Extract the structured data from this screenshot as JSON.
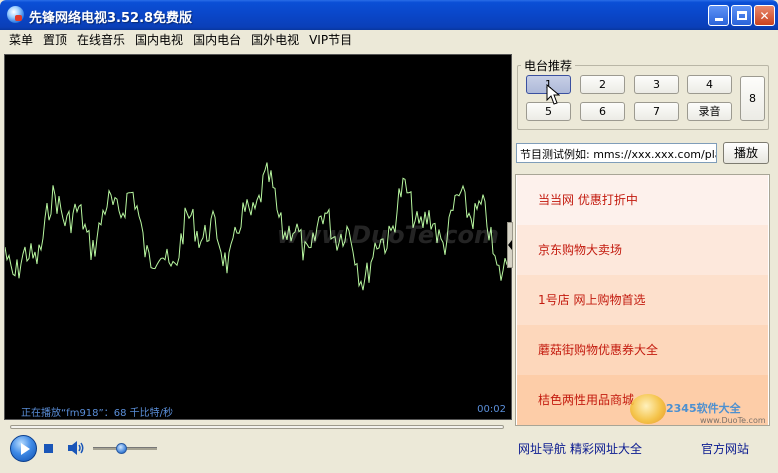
{
  "window": {
    "title": "先锋网络电视3.52.8免费版"
  },
  "menu": [
    "菜单",
    "置顶",
    "在线音乐",
    "国内电视",
    "国内电台",
    "国外电视",
    "VIP节目"
  ],
  "player": {
    "status": "正在播放“fm918”：68 千比特/秒",
    "time": "00:02",
    "watermark": "www.DuoTe.com",
    "volume_level": 0.45,
    "seek_progress": 0.0
  },
  "stations": {
    "title": "电台推荐",
    "buttons": [
      "1",
      "2",
      "3",
      "4",
      "5",
      "6",
      "7",
      "录音",
      "8"
    ],
    "selected": "1"
  },
  "url_bar": {
    "value": "节目测试例如: mms://xxx.xxx.com/play",
    "play_label": "播放"
  },
  "ads": [
    {
      "label": "当当网 优惠打折中",
      "color": "#fdf1ec"
    },
    {
      "label": "京东购物大卖场",
      "color": "#fde8dc"
    },
    {
      "label": "1号店 网上购物首选",
      "color": "#fde0cc"
    },
    {
      "label": "蘑菇街购物优惠券大全",
      "color": "#fdd7bb"
    },
    {
      "label": "桔色两性用品商城",
      "color": "#fdcda8"
    }
  ],
  "watermark_logo": {
    "text": "2345软件大全",
    "url": "www.DuoTe.com"
  },
  "footer": {
    "nav": "网址导航",
    "sites": "精彩网址大全",
    "official": "官方网站"
  },
  "colors": {
    "titlebar": "#0a46c8",
    "wave": "#b8f7a0",
    "ad_text": "#c31a0e",
    "link": "#0a1a90"
  }
}
